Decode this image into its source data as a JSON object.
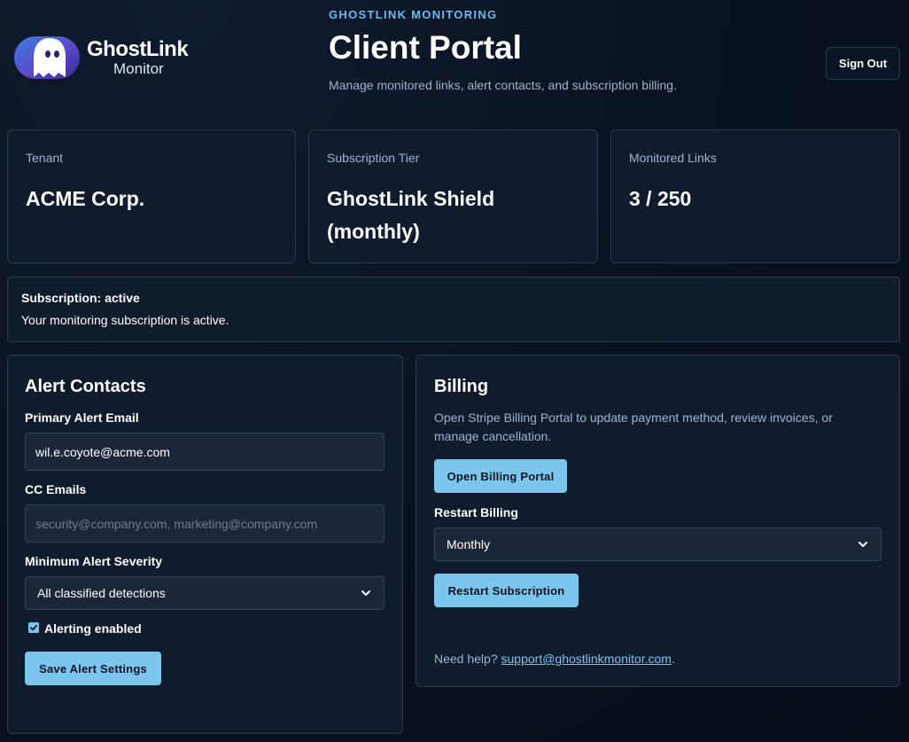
{
  "brand": {
    "logo_title": "GhostLink",
    "logo_subtitle": "Monitor",
    "eyebrow": "GHOSTLINK MONITORING",
    "title": "Client Portal",
    "subtitle": "Manage monitored links, alert contacts, and subscription billing."
  },
  "header": {
    "sign_out_label": "Sign Out"
  },
  "stats": [
    {
      "label": "Tenant",
      "value": "ACME Corp."
    },
    {
      "label": "Subscription Tier",
      "value": "GhostLink Shield (monthly)"
    },
    {
      "label": "Monitored Links",
      "value": "3 / 250"
    }
  ],
  "status": {
    "title": "Subscription: active",
    "message": "Your monitoring subscription is active."
  },
  "alerts": {
    "heading": "Alert Contacts",
    "primary_label": "Primary Alert Email",
    "primary_value": "wil.e.coyote@acme.com",
    "cc_label": "CC Emails",
    "cc_placeholder": "security@company.com, marketing@company.com",
    "severity_label": "Minimum Alert Severity",
    "severity_selected": "All classified detections",
    "enabled_label": "Alerting enabled",
    "enabled": true,
    "save_label": "Save Alert Settings"
  },
  "billing": {
    "heading": "Billing",
    "description": "Open Stripe Billing Portal to update payment method, review invoices, or manage cancellation.",
    "portal_button": "Open Billing Portal",
    "restart_label": "Restart Billing",
    "restart_selected": "Monthly",
    "restart_button": "Restart Subscription",
    "help_prefix": "Need help? ",
    "help_email": "support@ghostlinkmonitor.com",
    "help_suffix": "."
  },
  "colors": {
    "accent": "#7cc5ed",
    "eyebrow": "#6fb8ea",
    "card_bg": "#101b2e",
    "page_bg": "#08111f"
  }
}
